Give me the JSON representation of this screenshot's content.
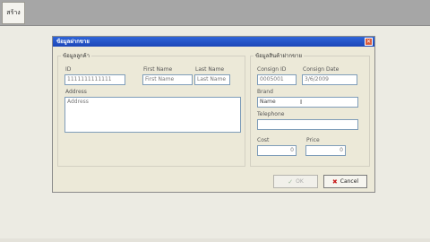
{
  "toolbar": {
    "button_label": "สร้าง"
  },
  "dialog": {
    "title": "ข้อมูลฝากขาย",
    "customer_group": {
      "legend": "ข้อมูลลูกค้า",
      "id_label": "ID",
      "id_value": "1111111111111",
      "first_name_label": "First Name",
      "first_name_placeholder": "First Name",
      "last_name_label": "Last Name",
      "last_name_placeholder": "Last Name",
      "address_label": "Address",
      "address_placeholder": "Address"
    },
    "consign_group": {
      "legend": "ข้อมูลสินค้าฝากขาย",
      "consign_id_label": "Consign ID",
      "consign_id_value": "0005001",
      "consign_date_label": "Consign Date",
      "consign_date_value": "3/6/2009",
      "brand_label": "Brand",
      "brand_value": "Name",
      "telephone_label": "Telephone",
      "telephone_value": "",
      "cost_label": "Cost",
      "cost_value": "0",
      "price_label": "Price",
      "price_value": "0"
    },
    "buttons": {
      "ok_label": "OK",
      "cancel_label": "Cancel"
    }
  }
}
